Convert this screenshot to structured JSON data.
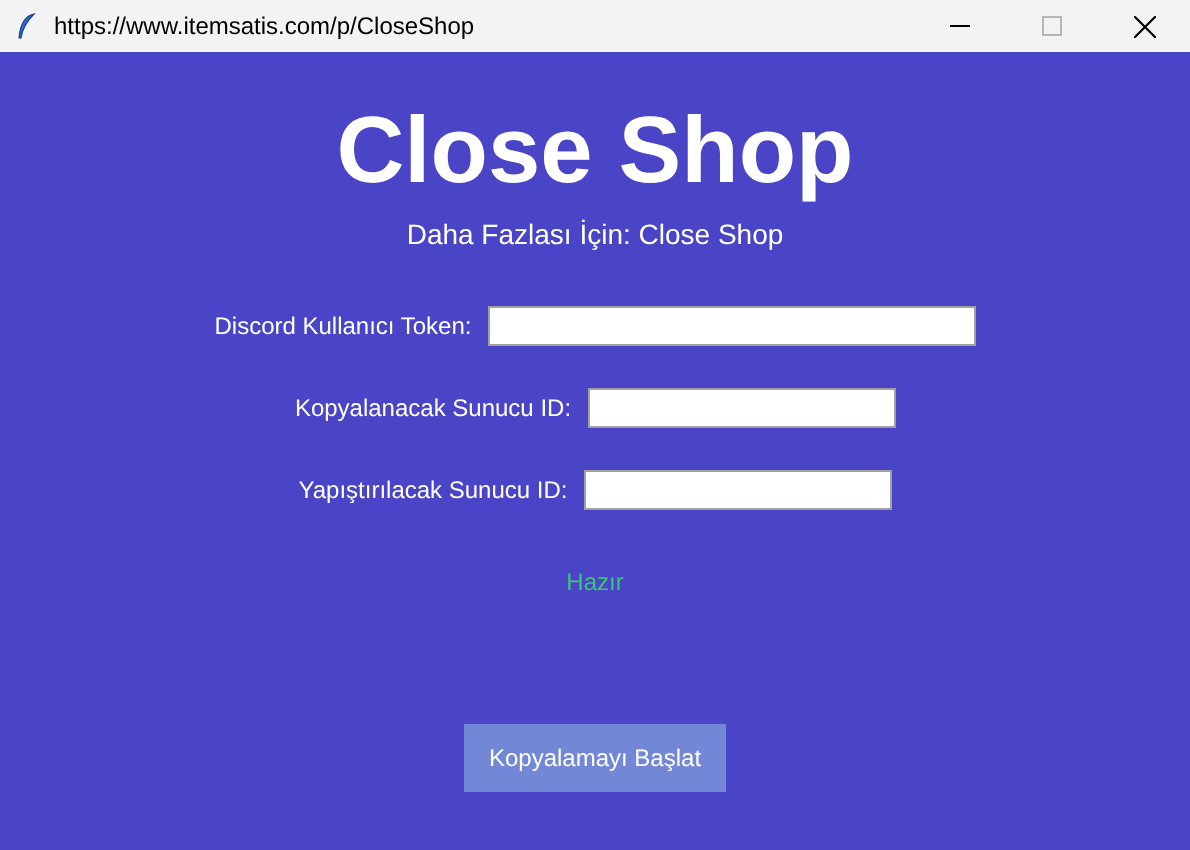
{
  "window": {
    "title": "https://www.itemsatis.com/p/CloseShop"
  },
  "heading": "Close Shop",
  "subtitle": "Daha Fazlası İçin: Close Shop",
  "fields": [
    {
      "label": "Discord Kullanıcı Token:",
      "kind": "long"
    },
    {
      "label": "Kopyalanacak Sunucu ID:",
      "kind": "short"
    },
    {
      "label": "Yapıştırılacak Sunucu ID:",
      "kind": "short"
    }
  ],
  "status": "Hazır",
  "button": "Kopyalamayı Başlat"
}
